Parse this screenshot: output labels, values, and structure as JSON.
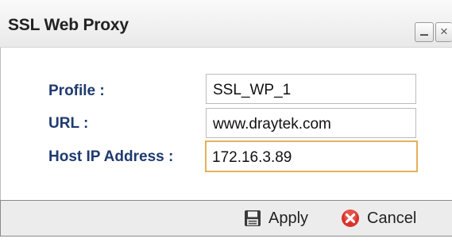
{
  "window": {
    "title": "SSL Web Proxy",
    "controls": {
      "minimize_icon": "minimize-icon",
      "close_icon": "close-icon",
      "close_glyph": "×"
    }
  },
  "form": {
    "profile": {
      "label": "Profile :",
      "value": "SSL_WP_1"
    },
    "url": {
      "label": "URL :",
      "value": "www.draytek.com"
    },
    "host_ip": {
      "label": "Host IP Address :",
      "value": "172.16.3.89"
    }
  },
  "footer": {
    "apply": {
      "label": "Apply",
      "icon": "save-icon"
    },
    "cancel": {
      "label": "Cancel",
      "icon": "cancel-icon"
    }
  },
  "colors": {
    "label_text": "#1f3a70",
    "focus_border": "#e3b15a",
    "cancel_icon": "#d8332b"
  }
}
